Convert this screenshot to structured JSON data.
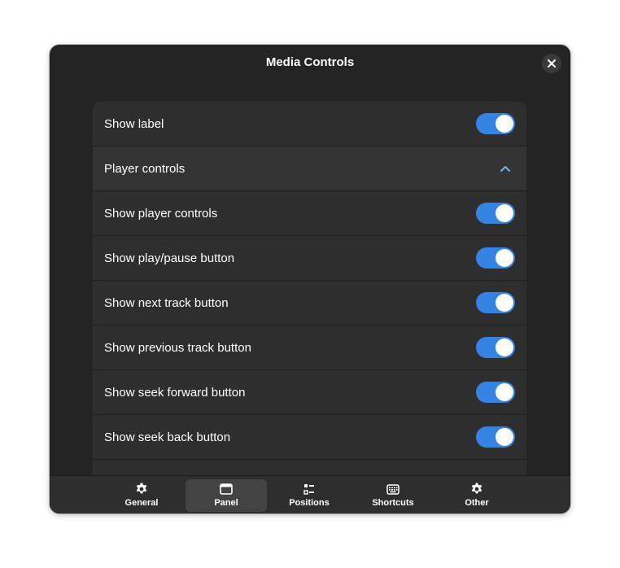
{
  "window": {
    "title": "Media Controls"
  },
  "settings": {
    "rows": [
      {
        "label": "Show label",
        "kind": "switch",
        "on": true
      },
      {
        "label": "Player controls",
        "kind": "expander",
        "expanded": true
      },
      {
        "label": "Show player controls",
        "kind": "switch",
        "on": true
      },
      {
        "label": "Show play/pause button",
        "kind": "switch",
        "on": true
      },
      {
        "label": "Show next track button",
        "kind": "switch",
        "on": true
      },
      {
        "label": "Show previous track button",
        "kind": "switch",
        "on": true
      },
      {
        "label": "Show seek forward button",
        "kind": "switch",
        "on": true
      },
      {
        "label": "Show seek back button",
        "kind": "switch",
        "on": true
      }
    ]
  },
  "viewswitcher": {
    "items": [
      {
        "label": "General",
        "icon": "gear-icon",
        "active": false
      },
      {
        "label": "Panel",
        "icon": "panel-icon",
        "active": true
      },
      {
        "label": "Positions",
        "icon": "positions-icon",
        "active": false
      },
      {
        "label": "Shortcuts",
        "icon": "keyboard-icon",
        "active": false
      },
      {
        "label": "Other",
        "icon": "gear-icon",
        "active": false
      }
    ]
  },
  "colors": {
    "accent": "#3584e4",
    "window_bg": "#242424",
    "row_bg": "#2e2e2e",
    "text": "#ffffff"
  }
}
